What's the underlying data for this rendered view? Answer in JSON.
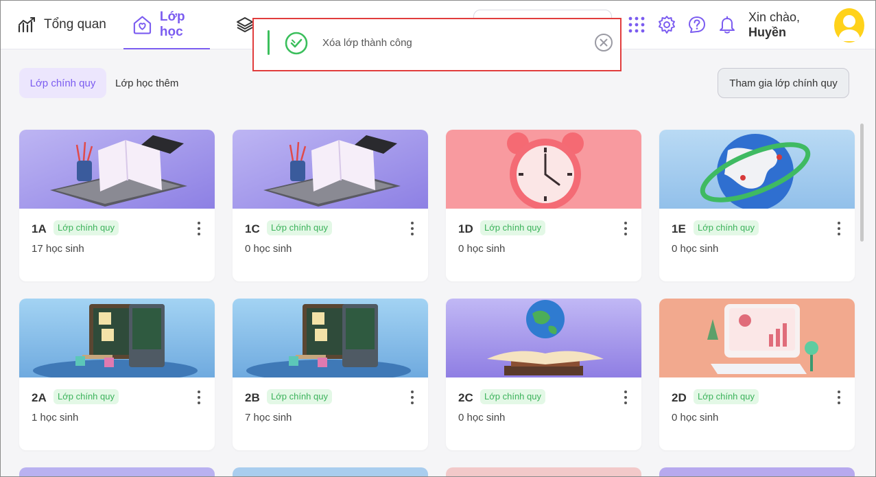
{
  "nav": {
    "overview_label": "Tổng quan",
    "class_label": "Lớp học",
    "active_color": "#7b5cf0"
  },
  "header": {
    "greeting": "Xin chào,",
    "user_name": "Huyền"
  },
  "toast": {
    "message": "Xóa lớp thành công",
    "status_color": "#3bbf5c"
  },
  "tabs": [
    {
      "label": "Lớp chính quy",
      "active": true
    },
    {
      "label": "Lớp học thêm",
      "active": false
    }
  ],
  "join_button_label": "Tham gia lớp chính quy",
  "badge_color": "#3bb25a",
  "cards": [
    {
      "name": "1A",
      "badge": "Lớp chính quy",
      "count": "17 học sinh",
      "image": "laptop-book"
    },
    {
      "name": "1C",
      "badge": "Lớp chính quy",
      "count": "0 học sinh",
      "image": "laptop-book"
    },
    {
      "name": "1D",
      "badge": "Lớp chính quy",
      "count": "0 học sinh",
      "image": "alarm-clock"
    },
    {
      "name": "1E",
      "badge": "Lớp chính quy",
      "count": "0 học sinh",
      "image": "globe-orbit"
    },
    {
      "name": "2A",
      "badge": "Lớp chính quy",
      "count": "1 học sinh",
      "image": "classroom-board"
    },
    {
      "name": "2B",
      "badge": "Lớp chính quy",
      "count": "7 học sinh",
      "image": "classroom-board"
    },
    {
      "name": "2C",
      "badge": "Lớp chính quy",
      "count": "0 học sinh",
      "image": "globe-books"
    },
    {
      "name": "2D",
      "badge": "Lớp chính quy",
      "count": "0 học sinh",
      "image": "computer-desk"
    }
  ]
}
